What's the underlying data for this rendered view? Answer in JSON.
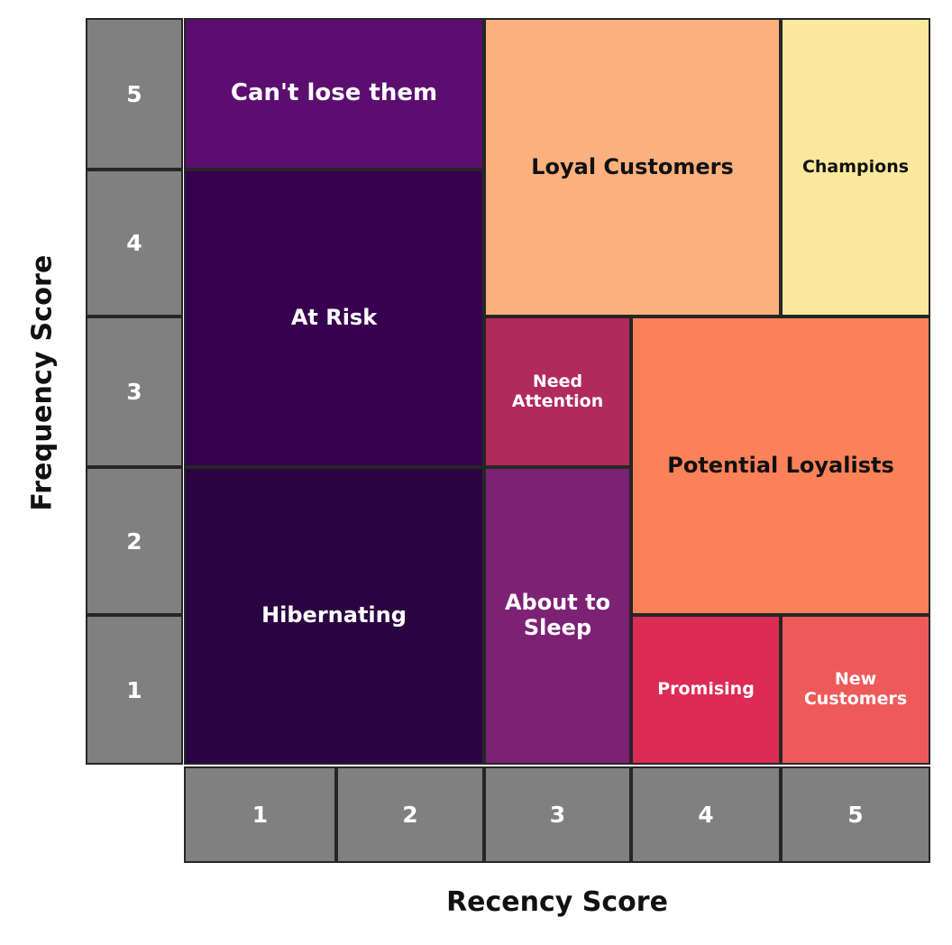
{
  "axes": {
    "y_title": "Frequency Score",
    "x_title": "Recency Score",
    "y_ticks": [
      "5",
      "4",
      "3",
      "2",
      "1"
    ],
    "x_ticks": [
      "1",
      "2",
      "3",
      "4",
      "5"
    ],
    "tick_fill": "#808080",
    "tick_text_color": "#FFFFFF",
    "border_color": "#262626"
  },
  "chart_data": {
    "type": "heatmap",
    "title": "",
    "xlabel": "Recency Score",
    "ylabel": "Frequency Score",
    "x": [
      1,
      2,
      3,
      4,
      5
    ],
    "y": [
      1,
      2,
      3,
      4,
      5
    ],
    "grid": true,
    "legend": "none",
    "segments": [
      {
        "label": "Can't lose them",
        "recency_range": [
          1,
          2
        ],
        "frequency_range": [
          5,
          5
        ],
        "color": "#5C0E70",
        "text_color": "#FFFFFF",
        "font_size": 26
      },
      {
        "label": "At Risk",
        "recency_range": [
          1,
          2
        ],
        "frequency_range": [
          3,
          4
        ],
        "color": "#37004F",
        "text_color": "#FFFFFF",
        "font_size": 24
      },
      {
        "label": "Hibernating",
        "recency_range": [
          1,
          2
        ],
        "frequency_range": [
          1,
          2
        ],
        "color": "#2A0440",
        "text_color": "#FFFFFF",
        "font_size": 24
      },
      {
        "label": "Loyal Customers",
        "recency_range": [
          3,
          4
        ],
        "frequency_range": [
          4,
          5
        ],
        "color": "#FCB07E",
        "text_color": "#111111",
        "font_size": 24
      },
      {
        "label": "Champions",
        "recency_range": [
          5,
          5
        ],
        "frequency_range": [
          4,
          5
        ],
        "color": "#FAE89C",
        "text_color": "#111111",
        "font_size": 19
      },
      {
        "label": "Need Attention",
        "recency_range": [
          3,
          3
        ],
        "frequency_range": [
          3,
          3
        ],
        "color": "#B02A5B",
        "text_color": "#FFFFFF",
        "font_size": 19
      },
      {
        "label": "Potential Loyalists",
        "recency_range": [
          4,
          5
        ],
        "frequency_range": [
          2,
          3
        ],
        "color": "#FB8159",
        "text_color": "#111111",
        "font_size": 24
      },
      {
        "label": "About to Sleep",
        "recency_range": [
          3,
          3
        ],
        "frequency_range": [
          1,
          2
        ],
        "color": "#7D2175",
        "text_color": "#FFFFFF",
        "font_size": 24
      },
      {
        "label": "Promising",
        "recency_range": [
          4,
          4
        ],
        "frequency_range": [
          1,
          1
        ],
        "color": "#DC2B54",
        "text_color": "#FFFFFF",
        "font_size": 19
      },
      {
        "label": "New Customers",
        "recency_range": [
          5,
          5
        ],
        "frequency_range": [
          1,
          1
        ],
        "color": "#EE5A5A",
        "text_color": "#FFFFFF",
        "font_size": 19
      }
    ]
  }
}
